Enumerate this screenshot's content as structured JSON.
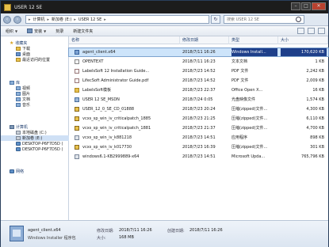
{
  "window": {
    "title": "USER 12 SE"
  },
  "address_bar": {
    "crumbs": [
      "计算机",
      "新加卷 (E:)",
      "USER 12 SE"
    ],
    "search_placeholder": "搜索 USER 12 SE"
  },
  "toolbar": {
    "organize": "组织",
    "install": "安装",
    "burn": "刻录",
    "new_folder": "新建文件夹"
  },
  "sidebar": {
    "favorites": {
      "label": "收藏夹",
      "items": [
        "下载",
        "桌面",
        "最近访问的位置"
      ]
    },
    "libraries": {
      "label": "库",
      "items": [
        "视频",
        "图片",
        "文档",
        "音乐"
      ]
    },
    "computer": {
      "label": "计算机",
      "items": [
        "本地磁盘 (C:)",
        "新加卷 (E:)",
        "DESKTOP-P6F7D5D (",
        "DESKTOP-P6F7D5D ("
      ]
    },
    "network": {
      "label": "网络"
    }
  },
  "columns": {
    "name": "名称",
    "date": "修改日期",
    "type": "类型",
    "size": "大小"
  },
  "files": [
    {
      "name": "agent_client.x64",
      "date": "2018/7/11 16:26",
      "type": "Windows Install...",
      "size": "170,620 KB",
      "icon": "msi",
      "selected": true
    },
    {
      "name": "OPENTEXT",
      "date": "2018/7/11 16:23",
      "type": "文本文档",
      "size": "1 KB",
      "icon": "txt",
      "selected": false
    },
    {
      "name": "LabelsSoft 12 Installation Guide...",
      "date": "2018/7/23 14:52",
      "type": "PDF 文件",
      "size": "2,242 KB",
      "icon": "pdf",
      "selected": false
    },
    {
      "name": "LifecSoft Administrator Guide.pdf",
      "date": "2018/7/23 14:52",
      "type": "PDF 文件",
      "size": "2,009 KB",
      "icon": "pdf",
      "selected": false
    },
    {
      "name": "LabelsSoft模板",
      "date": "2018/7/23 22:37",
      "type": "Office Open X...",
      "size": "16 KB",
      "icon": "fold",
      "selected": false
    },
    {
      "name": "USER 12 SE_MSDN",
      "date": "2018/7/24 0:05",
      "type": "光盘映像文件",
      "size": "1,574 KB",
      "icon": "iso",
      "selected": false
    },
    {
      "name": "USER_12_0_SE_CD_01888",
      "date": "2018/7/23 20:24",
      "type": "压缩(zipped)文件...",
      "size": "4,300 KB",
      "icon": "zip",
      "selected": false
    },
    {
      "name": "vcxs_sp_win_iv_criticalpatch_1885",
      "date": "2018/7/23 21:25",
      "type": "压缩(zipped)文件...",
      "size": "6,110 KB",
      "icon": "zip",
      "selected": false
    },
    {
      "name": "vcxs_sp_win_iv_criticalpatch_1881",
      "date": "2018/7/23 21:37",
      "type": "压缩(zipped)文件...",
      "size": "4,700 KB",
      "icon": "zip",
      "selected": false
    },
    {
      "name": "vcxs_sp_win_iv_k881218",
      "date": "2018/7/23 14:51",
      "type": "应用程序",
      "size": "898 KB",
      "icon": "cab",
      "selected": false
    },
    {
      "name": "vcxs_sp_win_iv_k017730",
      "date": "2018/7/23 16:39",
      "type": "压缩(zipped)文件...",
      "size": "301 KB",
      "icon": "zip",
      "selected": false
    },
    {
      "name": "windows6.1-KB2999889-x64",
      "date": "2018/7/23 14:51",
      "type": "Microsoft Upda...",
      "size": "765,796 KB",
      "icon": "cab",
      "selected": false
    }
  ],
  "details": {
    "name": "agent_client.x64",
    "type": "Windows Installer 程序包",
    "modified_label": "修改日期:",
    "modified_value": "2018/7/11 16:26",
    "created_label": "创建日期:",
    "created_value": "2018/7/11 16:26",
    "size_label": "大小:",
    "size_value": "168 MB"
  }
}
